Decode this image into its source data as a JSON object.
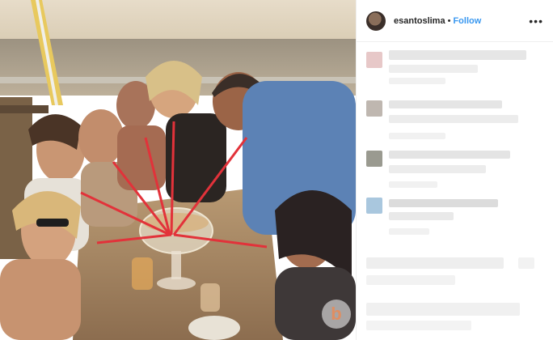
{
  "post": {
    "username": "esantoslima",
    "separator": "•",
    "follow_label": "Follow",
    "more_icon": "more-options-icon",
    "watermark_char": "b"
  },
  "colors": {
    "follow": "#3897f0",
    "text": "#262626",
    "border": "#efefef"
  },
  "photo": {
    "description_icon": "group-photo-image"
  }
}
